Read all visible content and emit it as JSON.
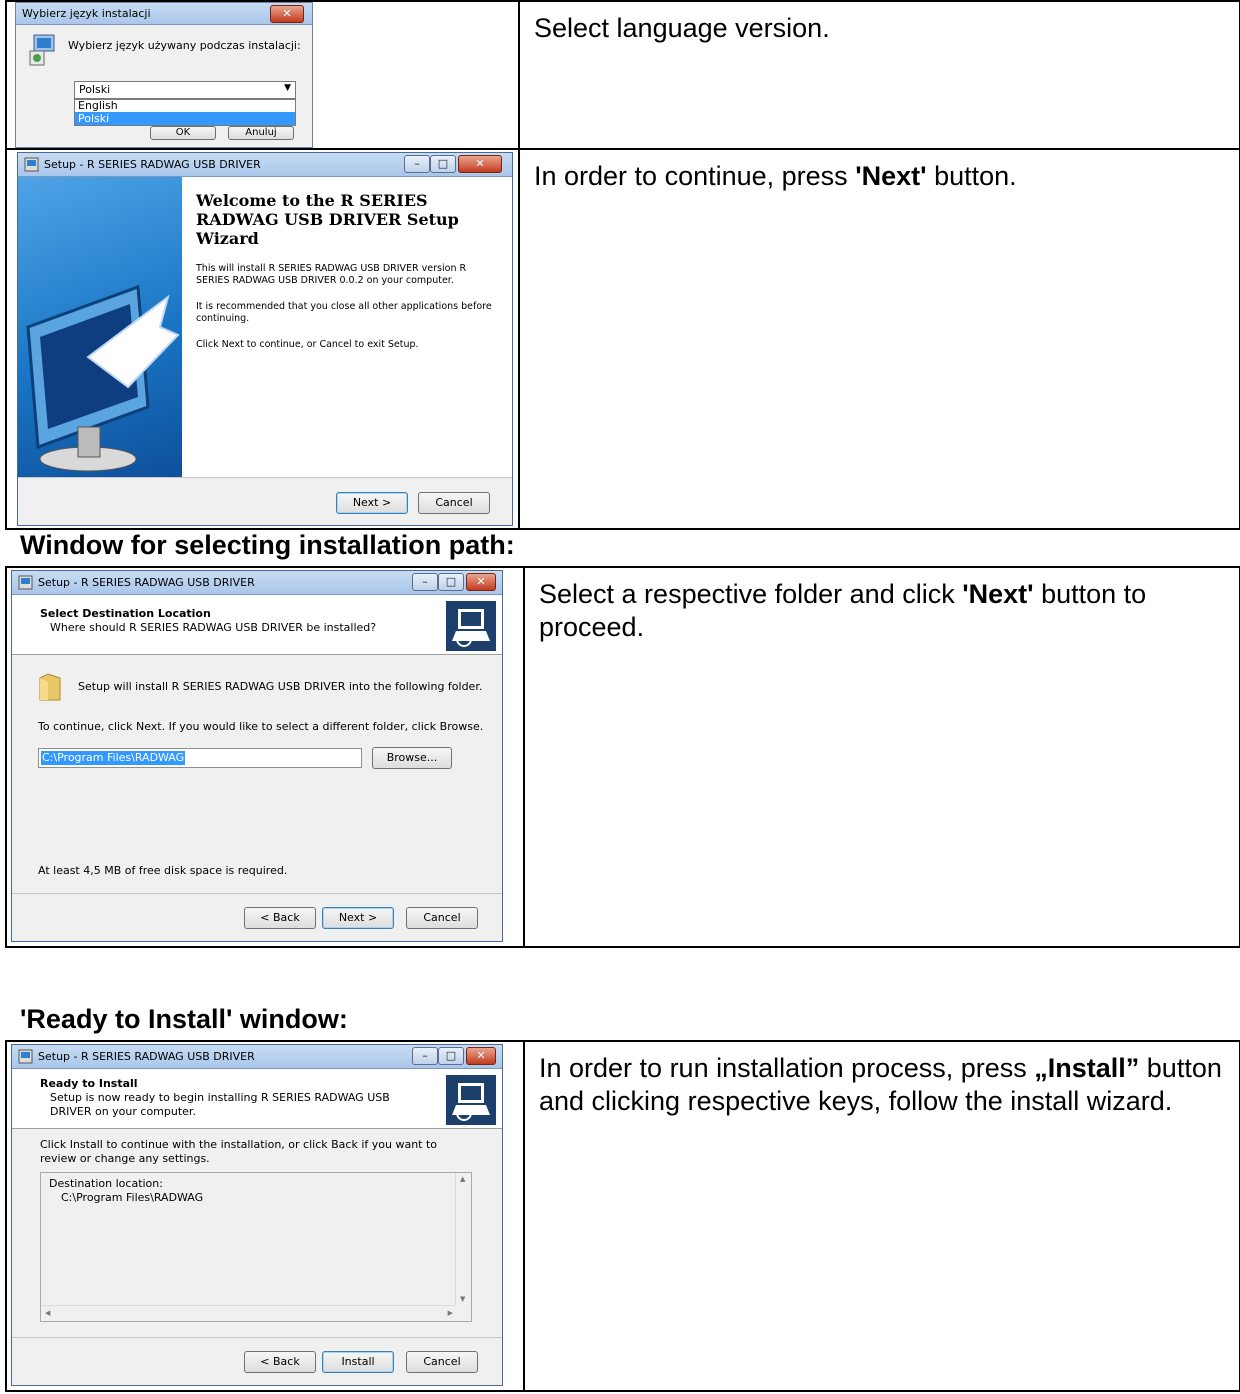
{
  "rows": [
    {
      "description_text": "Select language version."
    },
    {
      "description_prefix": "In order to continue, press ",
      "description_bold": "'Next'",
      "description_suffix": " button."
    }
  ],
  "section_path": {
    "heading": "Window for selecting installation path:",
    "description_prefix": "Select a respective folder and click ",
    "description_bold": "'Next'",
    "description_suffix": " button to proceed."
  },
  "section_ready": {
    "heading": "'Ready to Install' window:",
    "description_prefix": "In order to run installation process, press ",
    "description_bold": "„Install”",
    "description_suffix": " button and clicking respective keys, follow the install wizard."
  },
  "lang_dialog": {
    "title": "Wybierz język instalacji",
    "prompt": "Wybierz język używany podczas instalacji:",
    "selected_value": "Polski",
    "options": [
      "English",
      "Polski"
    ],
    "ok_label": "OK",
    "cancel_label": "Anuluj"
  },
  "welcome_dialog": {
    "title": "Setup - R SERIES RADWAG USB DRIVER",
    "heading": "Welcome to the R SERIES RADWAG USB DRIVER Setup Wizard",
    "para1": "This will install R SERIES RADWAG USB DRIVER version R SERIES RADWAG USB DRIVER 0.0.2 on your computer.",
    "para2": "It is recommended that you close all other applications before continuing.",
    "para3": "Click Next to continue, or Cancel to exit Setup.",
    "next_label": "Next >",
    "cancel_label": "Cancel"
  },
  "path_dialog": {
    "title": "Setup - R SERIES RADWAG USB DRIVER",
    "header_title": "Select Destination Location",
    "header_sub": "Where should R SERIES RADWAG USB DRIVER be installed?",
    "folder_text": "Setup will install R SERIES RADWAG USB DRIVER into the following folder.",
    "instruction": "To continue, click Next. If you would like to select a different folder, click Browse.",
    "path_value": "C:\\Program Files\\RADWAG",
    "browse_label": "Browse...",
    "space_text": "At least 4,5 MB of free disk space is required.",
    "back_label": "< Back",
    "next_label": "Next >",
    "cancel_label": "Cancel"
  },
  "ready_dialog": {
    "title": "Setup - R SERIES RADWAG USB DRIVER",
    "header_title": "Ready to Install",
    "header_sub": "Setup is now ready to begin installing R SERIES RADWAG USB DRIVER on your computer.",
    "instruction": "Click Install to continue with the installation, or click Back if you want to review or change any settings.",
    "memo_line1": "Destination location:",
    "memo_line2": "C:\\Program Files\\RADWAG",
    "back_label": "< Back",
    "install_label": "Install",
    "cancel_label": "Cancel"
  },
  "colors": {
    "titlebar": "#b9d1ee",
    "selection": "#3399ff",
    "wizard_blue": "#1a76c5",
    "dialog_bg": "#f0f0f0"
  }
}
